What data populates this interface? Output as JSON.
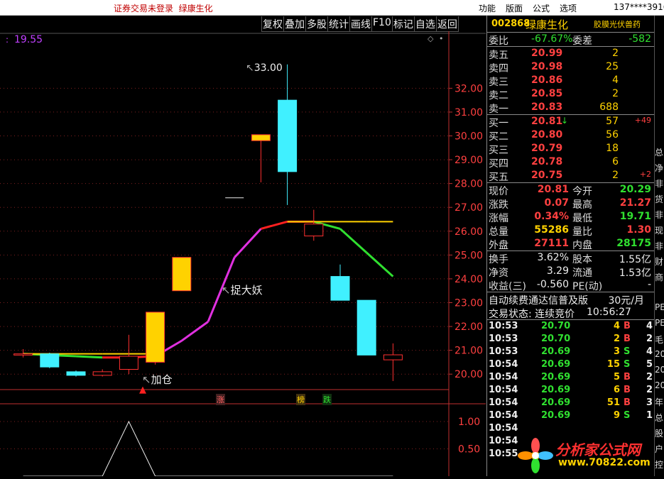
{
  "topbar": {
    "warning": "证券交易未登录",
    "stock_name": "绿康生化",
    "menu": [
      "功能",
      "版面",
      "公式",
      "选项"
    ],
    "user": "137****3916"
  },
  "toolbar": [
    "复权",
    "叠加",
    "多股",
    "统计",
    "画线",
    "F10",
    "标记",
    "自选",
    "返回"
  ],
  "chart": {
    "current_price_label": "19.55",
    "high_label": "33.00",
    "annotations": [
      "捉大妖",
      "加仓"
    ],
    "price_ticks": [
      "32.00",
      "31.00",
      "30.00",
      "29.00",
      "28.00",
      "27.00",
      "26.00",
      "25.00",
      "24.00",
      "23.00",
      "22.00",
      "21.00",
      "20.00"
    ],
    "bottom_markers": [
      "涨",
      "榜",
      "跌"
    ],
    "indicator_ticks": [
      "1.00",
      "0.50"
    ]
  },
  "chart_data": {
    "type": "candlestick",
    "y_axis_range": [
      19.5,
      33.5
    ],
    "candles": [
      {
        "o": 20.8,
        "c": 20.85,
        "h": 21.05,
        "l": 20.7,
        "up": true
      },
      {
        "o": 20.85,
        "c": 20.3,
        "h": 20.9,
        "l": 20.25,
        "up": false
      },
      {
        "o": 20.1,
        "c": 19.95,
        "h": 20.15,
        "l": 19.9,
        "up": false
      },
      {
        "o": 19.95,
        "c": 20.1,
        "h": 20.2,
        "l": 19.9,
        "up": true
      },
      {
        "o": 20.2,
        "c": 20.75,
        "h": 21.65,
        "l": 20.0,
        "up": true
      },
      {
        "o": 20.5,
        "c": 22.6,
        "h": 22.6,
        "l": 20.4,
        "up": true
      },
      {
        "o": 23.5,
        "c": 24.9,
        "h": 24.9,
        "l": 23.5,
        "up": true
      },
      null,
      {
        "o": 27.4,
        "c": 27.4,
        "h": 27.4,
        "l": 27.4,
        "up": true
      },
      {
        "o": 29.8,
        "c": 30.05,
        "h": 30.05,
        "l": 28.05,
        "up": true
      },
      {
        "o": 31.5,
        "c": 28.5,
        "h": 33.0,
        "l": 27.1,
        "up": false
      },
      {
        "o": 26.3,
        "c": 25.8,
        "h": 26.9,
        "l": 25.6,
        "up": true
      },
      {
        "o": 24.1,
        "c": 23.1,
        "h": 24.6,
        "l": 23.1,
        "up": false
      },
      {
        "o": 23.1,
        "c": 20.8,
        "h": 23.1,
        "l": 20.8,
        "up": false
      },
      {
        "o": 20.6,
        "c": 20.81,
        "h": 21.29,
        "l": 19.71,
        "up": true
      }
    ],
    "ma_line": [
      20.85,
      20.8,
      20.75,
      20.7,
      20.7,
      20.75,
      21.4,
      22.2,
      24.9,
      26.1,
      26.4,
      26.4,
      26.1,
      25.1,
      24.1
    ],
    "ma_colors": [
      "#ffd000",
      "#30e030",
      "#30e030",
      "#30e030",
      "#ff2020",
      "#ff2020",
      "#e030e0",
      "#e030e0",
      "#e030e0",
      "#e030e0",
      "#ff2020",
      "#ff2020",
      "#30e030",
      "#30e030",
      "#30e030"
    ],
    "ma2_line": [
      20.85,
      20.85,
      20.85,
      20.85,
      20.85,
      20.85,
      null,
      null,
      null,
      null,
      26.4,
      26.4,
      26.4,
      26.4,
      26.4
    ],
    "indicator": [
      0,
      0,
      0,
      0,
      1,
      0,
      0,
      0,
      0,
      0,
      0,
      0,
      0,
      0,
      0
    ]
  },
  "quote": {
    "code": "002868",
    "name": "绿康生化",
    "concept": "胶膜光伏兽药",
    "weibi_label": "委比",
    "weibi": "-67.67%",
    "weicha_label": "委差",
    "weicha": "-582",
    "asks": [
      {
        "label": "卖五",
        "price": "20.99",
        "vol": "2"
      },
      {
        "label": "卖四",
        "price": "20.98",
        "vol": "25"
      },
      {
        "label": "卖三",
        "price": "20.86",
        "vol": "4"
      },
      {
        "label": "卖二",
        "price": "20.85",
        "vol": "2"
      },
      {
        "label": "卖一",
        "price": "20.83",
        "vol": "688"
      }
    ],
    "bids": [
      {
        "label": "买一",
        "price": "20.81",
        "vol": "57",
        "extra": "+49",
        "arrow": "↓"
      },
      {
        "label": "买二",
        "price": "20.80",
        "vol": "56",
        "extra": "",
        "arrow": ""
      },
      {
        "label": "买三",
        "price": "20.79",
        "vol": "18",
        "extra": "",
        "arrow": ""
      },
      {
        "label": "买四",
        "price": "20.78",
        "vol": "6",
        "extra": "",
        "arrow": ""
      },
      {
        "label": "买五",
        "price": "20.75",
        "vol": "2",
        "extra": "+2",
        "arrow": ""
      }
    ],
    "stats": [
      {
        "l1": "现价",
        "v1": "20.81",
        "c1": "red",
        "l2": "今开",
        "v2": "20.29",
        "c2": "green"
      },
      {
        "l1": "涨跌",
        "v1": "0.07",
        "c1": "red",
        "l2": "最高",
        "v2": "21.27",
        "c2": "red"
      },
      {
        "l1": "涨幅",
        "v1": "0.34%",
        "c1": "red",
        "l2": "最低",
        "v2": "19.71",
        "c2": "green"
      },
      {
        "l1": "总量",
        "v1": "55286",
        "c1": "yellow",
        "l2": "量比",
        "v2": "1.30",
        "c2": "red"
      },
      {
        "l1": "外盘",
        "v1": "27111",
        "c1": "red",
        "l2": "内盘",
        "v2": "28175",
        "c2": "green"
      }
    ],
    "stats2": [
      {
        "l1": "换手",
        "v1": "3.62%",
        "l2": "股本",
        "v2": "1.55亿"
      },
      {
        "l1": "净资",
        "v1": "3.29",
        "l2": "流通",
        "v2": "1.53亿"
      },
      {
        "l1": "收益(三)",
        "v1": "-0.560",
        "l2": "PE(动)",
        "v2": "-"
      }
    ],
    "fee_text": "自动续费通达信普及版",
    "fee_price": "30元/月",
    "trade_status_label": "交易状态: 连续竞价",
    "trade_time": "10:56:27",
    "ticks": [
      {
        "time": "10:53",
        "price": "20.70",
        "vol": "4",
        "bs": "B",
        "n": "4"
      },
      {
        "time": "10:53",
        "price": "20.70",
        "vol": "2",
        "bs": "B",
        "n": "2"
      },
      {
        "time": "10:53",
        "price": "20.69",
        "vol": "3",
        "bs": "S",
        "n": "4"
      },
      {
        "time": "10:54",
        "price": "20.69",
        "vol": "15",
        "bs": "S",
        "n": "5"
      },
      {
        "time": "10:54",
        "price": "20.69",
        "vol": "5",
        "bs": "B",
        "n": "2"
      },
      {
        "time": "10:54",
        "price": "20.69",
        "vol": "6",
        "bs": "B",
        "n": "2"
      },
      {
        "time": "10:54",
        "price": "20.69",
        "vol": "51",
        "bs": "B",
        "n": "3"
      },
      {
        "time": "10:54",
        "price": "20.69",
        "vol": "9",
        "bs": "S",
        "n": "1"
      },
      {
        "time": "10:54",
        "price": "",
        "vol": "",
        "bs": "",
        "n": ""
      },
      {
        "time": "10:54",
        "price": "",
        "vol": "",
        "bs": "",
        "n": ""
      },
      {
        "time": "10:55",
        "price": "",
        "vol": "",
        "bs": "",
        "n": ""
      }
    ]
  },
  "far_right": [
    "总",
    "净",
    "非",
    "货",
    "非",
    "现",
    "非",
    "财",
    "商",
    "",
    "PE",
    "PE",
    "毛",
    "20",
    "20",
    "20",
    "年",
    "总",
    "股",
    "户",
    "控"
  ],
  "watermark": {
    "site": "分析家公式网",
    "url": "www.70822.com"
  },
  "colors": {
    "up": "#ff3030",
    "down": "#40e0ff",
    "yellow": "#ffd200",
    "magenta": "#e030e0",
    "green": "#30e030"
  }
}
